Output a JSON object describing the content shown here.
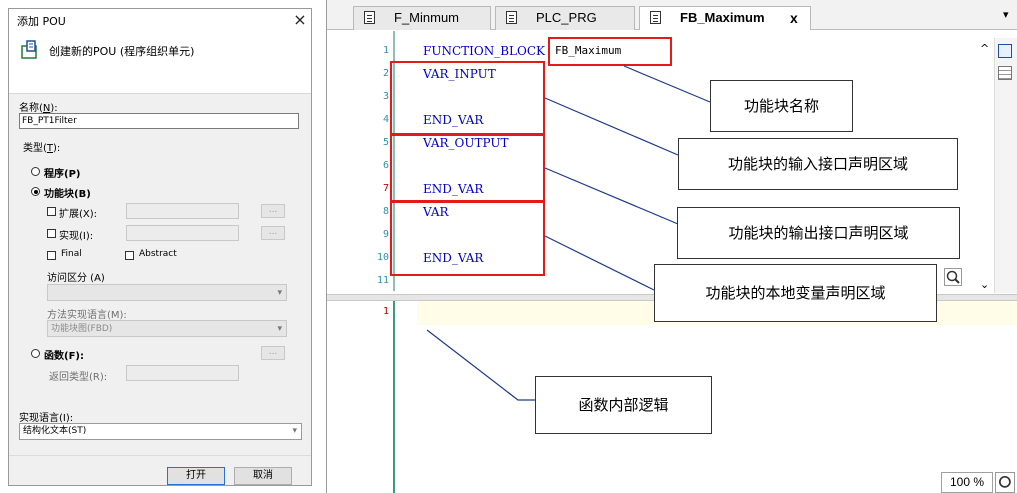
{
  "dialog": {
    "title": "添加 POU",
    "close": "×",
    "subtitle": "创建新的POU (程序组织单元)",
    "name_label": "名称(",
    "name_key": "N",
    "name_label_end": "):",
    "name_value": "FB_PT1Filter",
    "type_label": "类型(",
    "type_key": "T",
    "type_label_end": "):",
    "program": "程序(P)",
    "function_block": "功能块(B)",
    "extends": "扩展(X):",
    "implements": "实现(I):",
    "final": "Final",
    "abstract": "Abstract",
    "access_specifier": "访问区分 (A)",
    "method_impl_lang": "方法实现语言(M):",
    "method_impl_value": "功能块图(FBD)",
    "function": "函数(F):",
    "return_type": "返回类型(R):",
    "dots": "...",
    "impl_lang_label": "实现语言(I):",
    "impl_lang_value": "结构化文本(ST)",
    "open_button": "打开",
    "cancel_button": "取消"
  },
  "editor": {
    "tabs": [
      {
        "label": "F_Minmum"
      },
      {
        "label": "PLC_PRG"
      },
      {
        "label": "FB_Maximum",
        "close": "x"
      }
    ],
    "tab_overflow": "▾",
    "line_numbers": [
      "1",
      "2",
      "3",
      "4",
      "5",
      "6",
      "7",
      "8",
      "9",
      "10",
      "11"
    ],
    "code": {
      "l1_kw": "FUNCTION_BLOCK",
      "l1_name": "FB_Maximum",
      "l2": "VAR_INPUT",
      "l4": "END_VAR",
      "l5": "VAR_OUTPUT",
      "l7": "END_VAR",
      "l8": "VAR",
      "l10": "END_VAR"
    },
    "impl_line_number": "1",
    "zoom": "100 %"
  },
  "annotations": {
    "fb_name": "功能块名称",
    "input_area": "功能块的输入接口声明区域",
    "output_area": "功能块的输出接口声明区域",
    "local_area": "功能块的本地变量声明区域",
    "impl_logic": "函数内部逻辑"
  },
  "colors": {
    "keyword": "#0000c0",
    "line_number": "#2b91af",
    "highlight_box": "#e21a1a",
    "current_line": "#fffde7"
  }
}
